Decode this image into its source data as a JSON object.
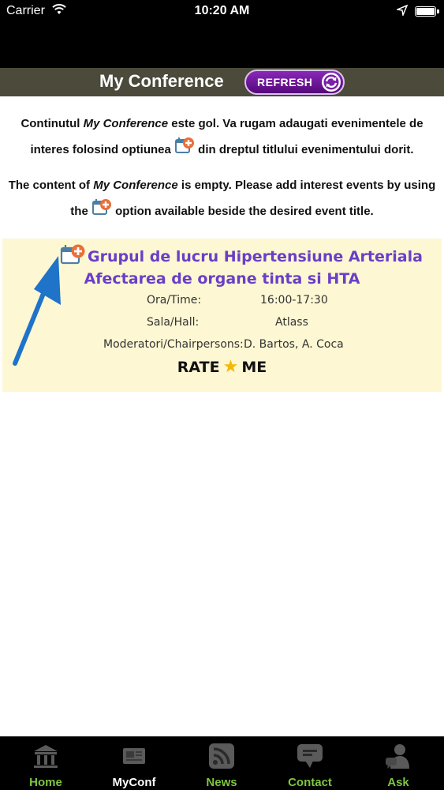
{
  "status_bar": {
    "carrier": "Carrier",
    "time": "10:20 AM"
  },
  "header": {
    "title": "My Conference",
    "refresh_label": "REFRESH"
  },
  "message_ro": {
    "part1": "Continutul ",
    "em": "My Conference",
    "part2": " este gol. Va rugam adaugati evenimentele de interes folosind optiunea ",
    "part3": " din dreptul titlului evenimentului dorit."
  },
  "message_en": {
    "part1": "The content of ",
    "em": "My Conference",
    "part2": " is empty. Please add interest events by using the ",
    "part3": " option available beside the desired event title."
  },
  "sample_event": {
    "title_line1": "Grupul de lucru Hipertensiune Arteriala",
    "title_line2": "Afectarea de organe tinta si HTA",
    "time_label": "Ora/Time:",
    "time_value": "16:00-17:30",
    "hall_label": "Sala/Hall:",
    "hall_value": "Atlass",
    "moderators_label": "Moderatori/Chairpersons:",
    "moderators_value": "D. Bartos, A. Coca",
    "rate_left": "RATE",
    "rate_right": "ME"
  },
  "tabs": [
    {
      "label": "Home",
      "icon": "home-icon",
      "active": false
    },
    {
      "label": "MyConf",
      "icon": "myconf-icon",
      "active": true
    },
    {
      "label": "News",
      "icon": "rss-icon",
      "active": false
    },
    {
      "label": "Contact",
      "icon": "chat-icon",
      "active": false
    },
    {
      "label": "Ask",
      "icon": "ask-icon",
      "active": false
    }
  ],
  "colors": {
    "header_bg": "#4b4a3b",
    "refresh_bg": "#6a1996",
    "event_title": "#6a3fc7",
    "card_bg": "#fdf7d3",
    "tab_label": "#7ec63f",
    "arrow": "#1f73c9"
  }
}
